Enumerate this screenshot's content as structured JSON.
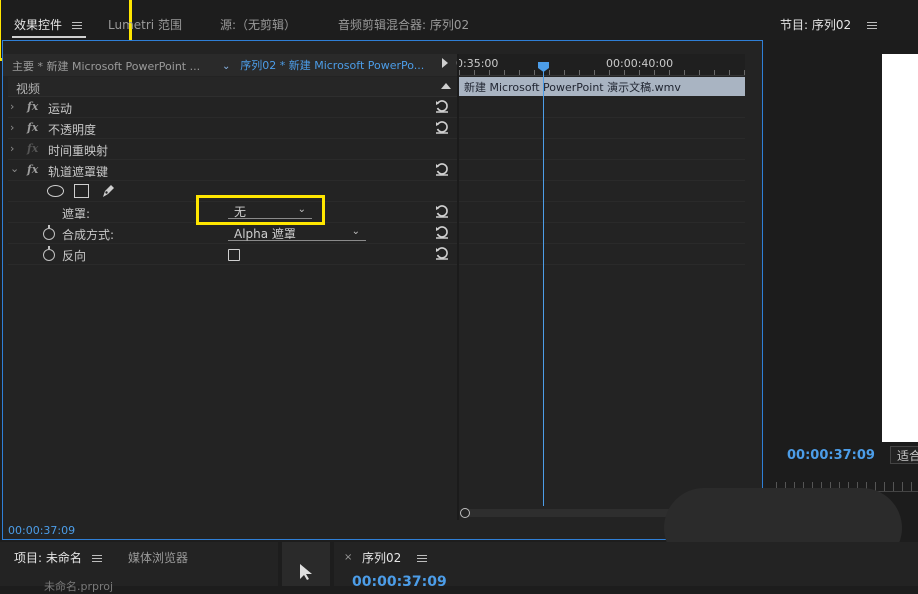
{
  "top_tabs": {
    "effect_controls": "效果控件",
    "lumetri": "Lumetri 范围",
    "source": "源:（无剪辑）",
    "audio_mixer": "音频剪辑混合器: 序列02",
    "program": "节目: 序列02"
  },
  "clip_header": {
    "master": "主要 * 新建 Microsoft PowerPoint ...",
    "sequence": "序列02 * 新建 Microsoft PowerPo..."
  },
  "effects": {
    "section": "视频",
    "motion": "运动",
    "opacity": "不透明度",
    "time_remap": "时间重映射",
    "track_matte": "轨道遮罩键",
    "matte_label": "遮罩:",
    "matte_value": "无",
    "composite_label": "合成方式:",
    "composite_value": "Alpha 遮罩",
    "reverse_label": "反向"
  },
  "timeline": {
    "time_left": "0:35:00",
    "time_right": "00:00:40:00",
    "clip_name": "新建 Microsoft PowerPoint 演示文稿.wmv"
  },
  "effect_timecode": "00:00:37:09",
  "program": {
    "timecode": "00:00:37:09",
    "fit": "适合"
  },
  "bottom": {
    "project_tab": "项目: 未命名",
    "media_browser": "媒体浏览器",
    "sequence_tab": "序列02",
    "sequence_timecode": "00:00:37:09",
    "project_item": "未命名.prproj"
  },
  "colors": {
    "highlight": "#ffe600",
    "accent_blue": "#4c9de8",
    "clip": "#a9b4c2"
  }
}
